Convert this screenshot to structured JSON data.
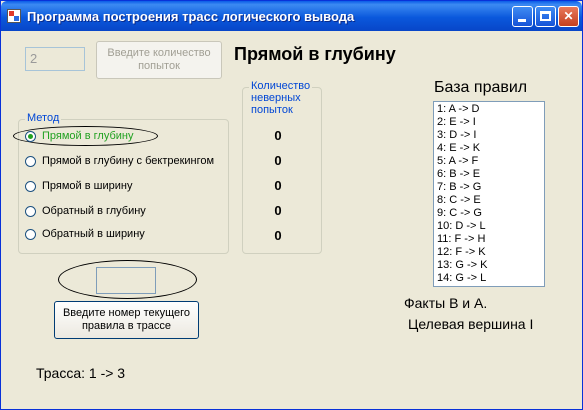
{
  "window": {
    "title": "Программа построения трасс логического вывода"
  },
  "attempts_input": {
    "value": "2"
  },
  "attempts_button": {
    "label_line1": "Введите количество",
    "label_line2": "попыток"
  },
  "method_heading": "Прямой в глубину",
  "method_group": {
    "legend": "Метод",
    "options": [
      {
        "label": "Прямой в глубину",
        "selected": true
      },
      {
        "label": "Прямой в глубину с бектрекингом",
        "selected": false
      },
      {
        "label": "Прямой в ширину",
        "selected": false
      },
      {
        "label": "Обратный в глубину",
        "selected": false
      },
      {
        "label": "Обратный в ширину",
        "selected": false
      }
    ]
  },
  "wrong_attempts": {
    "legend_line1": "Количество",
    "legend_line2": "неверных",
    "legend_line3": "попыток",
    "values": [
      "0",
      "0",
      "0",
      "0",
      "0"
    ]
  },
  "rules": {
    "title": "База правил",
    "items": [
      "1: A -> D",
      "2: E -> I",
      "3: D -> I",
      "4: E -> K",
      "5: A -> F",
      "6: B -> E",
      "7: B -> G",
      "8: C -> E",
      "9: C -> G",
      "10: D -> L",
      "11: F -> H",
      "12: F -> K",
      "13: G -> K",
      "14: G -> L"
    ]
  },
  "facts": {
    "line1": "Факты B и A.",
    "line2": "Целевая вершина I"
  },
  "rule_number_input": {
    "value": ""
  },
  "rule_number_button": {
    "label_line1": "Введите номер текущего",
    "label_line2": "правила в трассе"
  },
  "trace": {
    "text": "Трасса: 1 -> 3"
  },
  "colors": {
    "title_bar": "#0a58dc",
    "selected_option": "#21a121",
    "legend": "#0046d5"
  }
}
